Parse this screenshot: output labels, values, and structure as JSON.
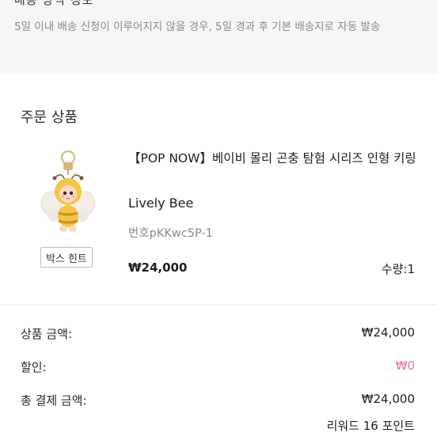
{
  "delivery_section": {
    "title": "배송 방식 정보",
    "notice": "5일 이내 배송 신청이 이루어지지 않을 경우, 5일 경과 후 기본 배송지로 자동 발송"
  },
  "order": {
    "section_title": "주문 상품",
    "product": {
      "image_icon": "lively-bee-keyring-figure",
      "title": "【POP NOW】베이비 몰리 곤충 탐험 시리즈 인형 키링",
      "option": "Lively Bee",
      "number": "번호pKKwc5P-1",
      "price": "₩24,000",
      "quantity": "수량:1",
      "hint_button": "박스 힌트"
    },
    "summary": {
      "product_amount_label": "상품 금액:",
      "product_amount_value": "₩24,000",
      "discount_label": "할인:",
      "discount_value": "₩0",
      "total_label": "총 결제 금액:",
      "total_value": "₩24,000",
      "reward": "리워드 16 포인트"
    },
    "colors": {
      "discount": "#e8759a",
      "muted_text": "#8a8a8a",
      "top_background": "#f6f6f6"
    }
  }
}
